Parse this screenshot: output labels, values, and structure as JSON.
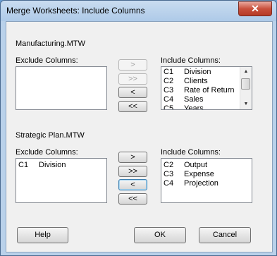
{
  "window": {
    "title": "Merge Worksheets: Include Columns",
    "close_label": "✕"
  },
  "section1": {
    "worksheet": "Manufacturing.MTW",
    "exclude_label": "Exclude Columns:",
    "include_label": "Include Columns:",
    "exclude_items": [],
    "include_items": [
      {
        "col": "C1",
        "name": "Division"
      },
      {
        "col": "C2",
        "name": "Clients"
      },
      {
        "col": "C3",
        "name": "Rate of Return"
      },
      {
        "col": "C4",
        "name": "Sales"
      },
      {
        "col": "C5",
        "name": "Years"
      }
    ],
    "buttons": {
      "add": ">",
      "add_all": ">>",
      "remove": "<",
      "remove_all": "<<"
    }
  },
  "section2": {
    "worksheet": "Strategic Plan.MTW",
    "exclude_label": "Exclude Columns:",
    "include_label": "Include Columns:",
    "exclude_items": [
      {
        "col": "C1",
        "name": "Division"
      }
    ],
    "include_items": [
      {
        "col": "C2",
        "name": "Output"
      },
      {
        "col": "C3",
        "name": "Expense"
      },
      {
        "col": "C4",
        "name": "Projection"
      }
    ],
    "buttons": {
      "add": ">",
      "add_all": ">>",
      "remove": "<",
      "remove_all": "<<"
    }
  },
  "footer": {
    "help": "Help",
    "ok": "OK",
    "cancel": "Cancel"
  }
}
